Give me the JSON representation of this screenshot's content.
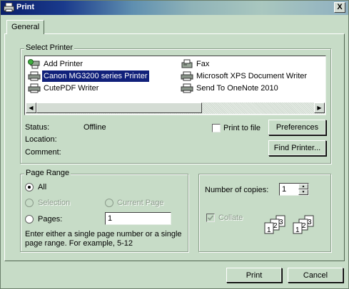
{
  "window": {
    "title": "Print",
    "close_glyph": "X"
  },
  "tabs": [
    {
      "label": "General"
    }
  ],
  "select_printer": {
    "label": "Select Printer",
    "printers": [
      {
        "name": "Add Printer",
        "icon": "add-printer-icon"
      },
      {
        "name": "Canon MG3200 series Printer",
        "icon": "printer-icon",
        "selected": true
      },
      {
        "name": "CutePDF Writer",
        "icon": "printer-icon"
      },
      {
        "name": "Fax",
        "icon": "fax-icon"
      },
      {
        "name": "Microsoft XPS Document Writer",
        "icon": "printer-icon"
      },
      {
        "name": "Send To OneNote 2010",
        "icon": "printer-icon"
      }
    ],
    "status_label": "Status:",
    "status_value": "Offline",
    "location_label": "Location:",
    "comment_label": "Comment:",
    "print_to_file": "Print to file",
    "preferences": "Preferences",
    "find_printer": "Find Printer..."
  },
  "page_range": {
    "label": "Page Range",
    "all": "All",
    "selection": "Selection",
    "current_page": "Current Page",
    "pages": "Pages:",
    "pages_value": "1",
    "help_line1": "Enter either a single page number or a single",
    "help_line2": "page range.  For example, 5-12"
  },
  "copies": {
    "label": "Number of copies:",
    "value": "1",
    "collate": "Collate",
    "collate_checked": true,
    "illus_nums": [
      "1",
      "2",
      "3",
      "1",
      "2",
      "3"
    ]
  },
  "footer": {
    "print": "Print",
    "cancel": "Cancel"
  },
  "colors": {
    "dialog_bg": "#c7dcc7",
    "selection": "#10207a"
  }
}
